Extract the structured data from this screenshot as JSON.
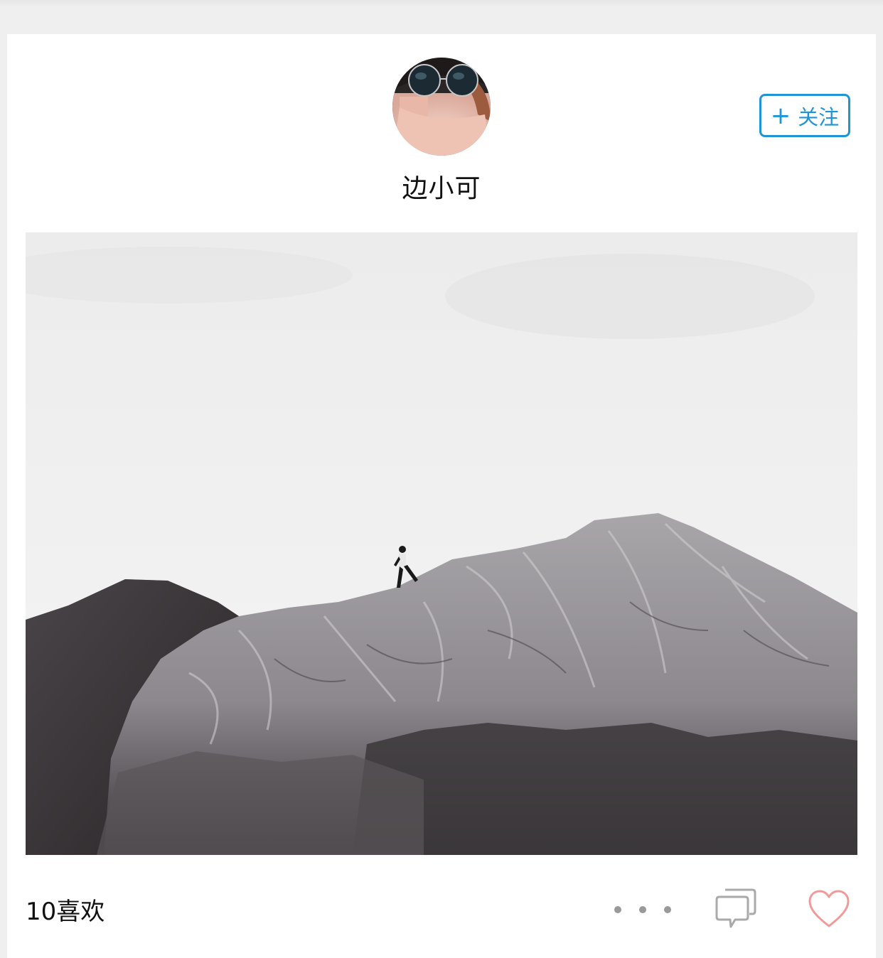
{
  "post": {
    "author": {
      "name": "边小可",
      "avatar_icon": "avatar-photo"
    },
    "follow_button": {
      "plus": "+",
      "label": "关注"
    },
    "photo_icon": "mountain-runner-photo",
    "likes_text": "10喜欢"
  },
  "icons": {
    "more": "more-dots-icon",
    "comment": "comment-icon",
    "like": "heart-icon"
  },
  "colors": {
    "accent": "#1f95d6",
    "heart": "#f19a9a",
    "icon_gray": "#aaaaaa"
  }
}
